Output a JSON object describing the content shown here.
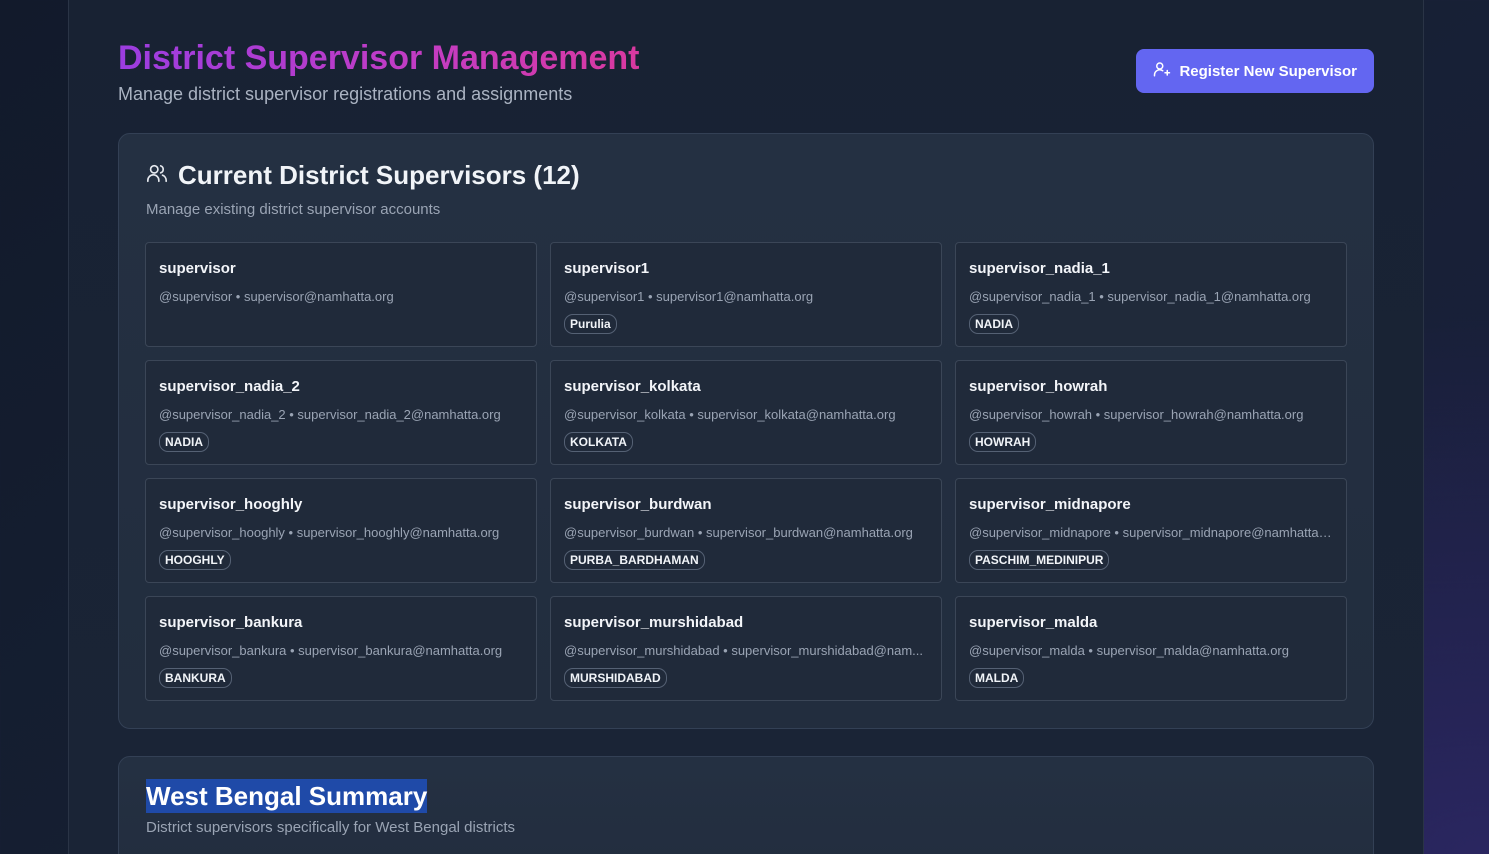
{
  "header": {
    "title": "District Supervisor Management",
    "subtitle": "Manage district supervisor registrations and assignments",
    "register_button": "Register New Supervisor",
    "register_icon": "user-plus-icon"
  },
  "current": {
    "icon": "users-icon",
    "title": "Current District Supervisors (12)",
    "description": "Manage existing district supervisor accounts",
    "supervisors": [
      {
        "name": "supervisor",
        "meta": "@supervisor • supervisor@namhatta.org",
        "district": ""
      },
      {
        "name": "supervisor1",
        "meta": "@supervisor1 • supervisor1@namhatta.org",
        "district": "Purulia"
      },
      {
        "name": "supervisor_nadia_1",
        "meta": "@supervisor_nadia_1 • supervisor_nadia_1@namhatta.org",
        "district": "NADIA"
      },
      {
        "name": "supervisor_nadia_2",
        "meta": "@supervisor_nadia_2 • supervisor_nadia_2@namhatta.org",
        "district": "NADIA"
      },
      {
        "name": "supervisor_kolkata",
        "meta": "@supervisor_kolkata • supervisor_kolkata@namhatta.org",
        "district": "KOLKATA"
      },
      {
        "name": "supervisor_howrah",
        "meta": "@supervisor_howrah • supervisor_howrah@namhatta.org",
        "district": "HOWRAH"
      },
      {
        "name": "supervisor_hooghly",
        "meta": "@supervisor_hooghly • supervisor_hooghly@namhatta.org",
        "district": "HOOGHLY"
      },
      {
        "name": "supervisor_burdwan",
        "meta": "@supervisor_burdwan • supervisor_burdwan@namhatta.org",
        "district": "PURBA_BARDHAMAN"
      },
      {
        "name": "supervisor_midnapore",
        "meta": "@supervisor_midnapore • supervisor_midnapore@namhatta....",
        "district": "PASCHIM_MEDINIPUR"
      },
      {
        "name": "supervisor_bankura",
        "meta": "@supervisor_bankura • supervisor_bankura@namhatta.org",
        "district": "BANKURA"
      },
      {
        "name": "supervisor_murshidabad",
        "meta": "@supervisor_murshidabad • supervisor_murshidabad@nam...",
        "district": "MURSHIDABAD"
      },
      {
        "name": "supervisor_malda",
        "meta": "@supervisor_malda • supervisor_malda@namhatta.org",
        "district": "MALDA"
      }
    ]
  },
  "summary": {
    "title": "West Bengal Summary",
    "description": "District supervisors specifically for West Bengal districts"
  },
  "colors": {
    "accent": "#6366f1",
    "title_gradient_start": "#9b3de0",
    "title_gradient_end": "#d9399f",
    "selection": "#1f4aa8"
  }
}
